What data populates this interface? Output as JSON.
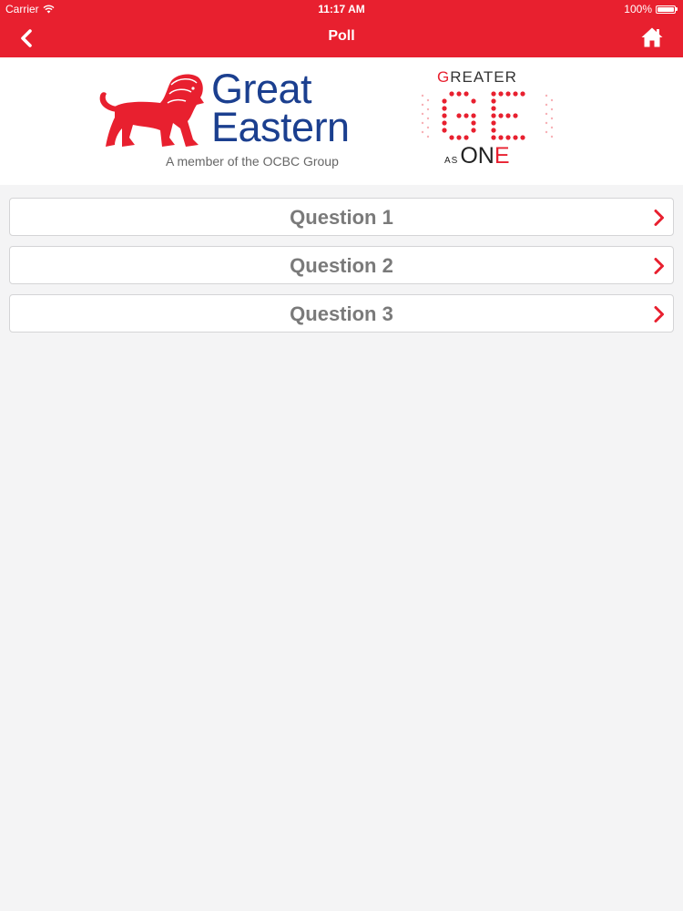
{
  "status_bar": {
    "carrier": "Carrier",
    "time": "11:17 AM",
    "battery": "100%",
    "wifi_icon": "wifi-icon",
    "battery_icon": "battery-icon"
  },
  "nav": {
    "title": "Poll",
    "back_icon": "chevron-left-icon",
    "home_icon": "home-icon"
  },
  "logos": {
    "great_eastern": {
      "line1": "Great",
      "line2": "Eastern",
      "tagline": "A member of the OCBC Group",
      "icon": "lion-icon"
    },
    "greater_as_one": {
      "greater_first": "G",
      "greater_rest": "REATER",
      "as": "AS",
      "one_first": "ON",
      "one_last": "E",
      "mark": "GE"
    }
  },
  "questions": [
    {
      "label": "Question 1"
    },
    {
      "label": "Question 2"
    },
    {
      "label": "Question 3"
    }
  ],
  "colors": {
    "brand_red": "#e8202f",
    "brand_blue": "#1b3f8f",
    "background": "#f4f4f5",
    "question_text": "#7a7a7a"
  }
}
